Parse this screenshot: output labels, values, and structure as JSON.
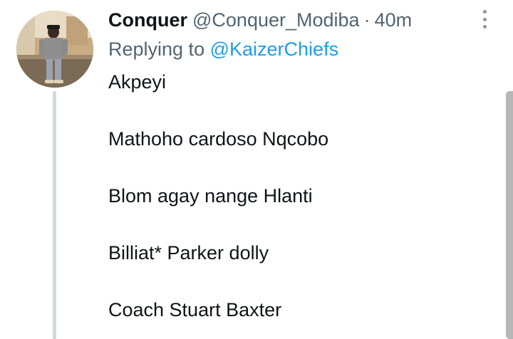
{
  "tweet": {
    "author": {
      "display_name": "Conquer",
      "handle": "@Conquer_Modiba"
    },
    "separator": "·",
    "time": "40m",
    "reply": {
      "prefix": "Replying to ",
      "mention": "@KaizerChiefs"
    },
    "lines": [
      "Akpeyi",
      "Mathoho cardoso Nqcobo",
      "Blom agay nange Hlanti",
      "Billiat* Parker dolly",
      "Coach Stuart Baxter"
    ]
  },
  "icons": {
    "more": "more-horizontal-dots-icon"
  },
  "colors": {
    "text_primary": "#0f1419",
    "text_secondary": "#536471",
    "link": "#1d9bf0",
    "thread_line": "#cfd9de"
  }
}
